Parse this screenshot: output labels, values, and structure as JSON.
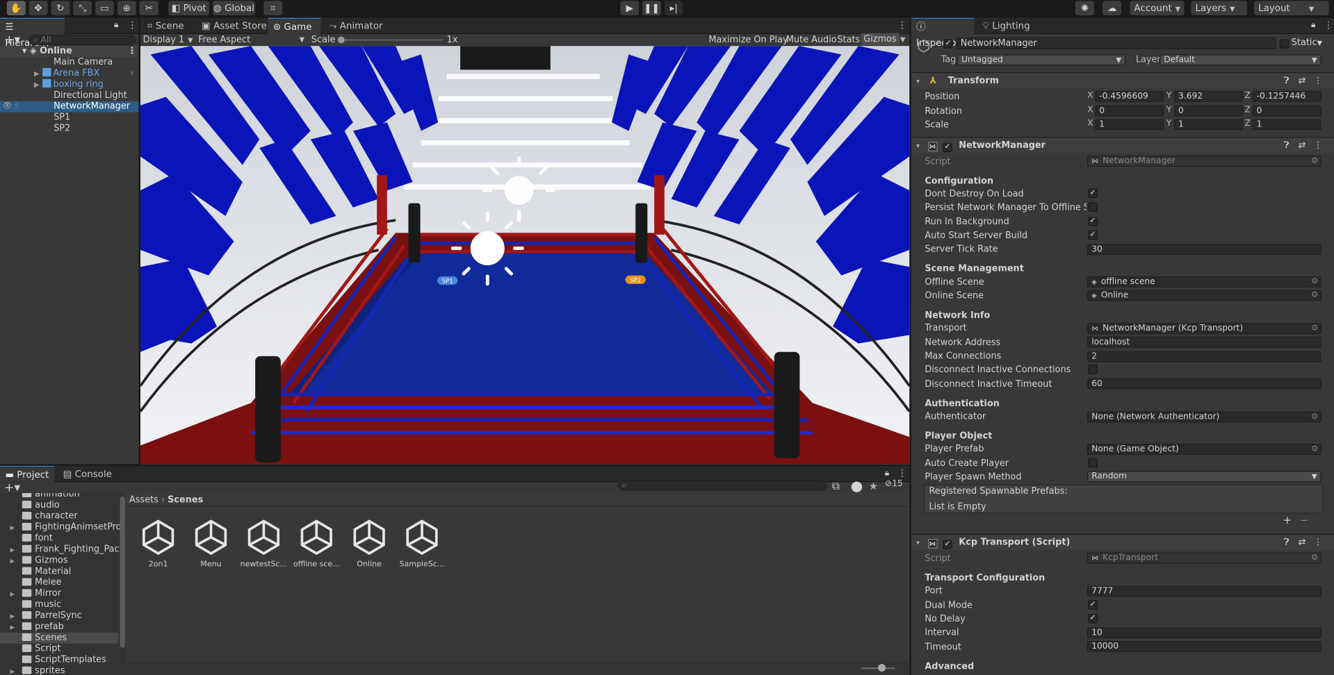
{
  "toolbar": {
    "pivot": "Pivot",
    "global": "Global",
    "account": "Account",
    "layers": "Layers",
    "layout": "Layout"
  },
  "hierarchy": {
    "tab": "Hierarchy",
    "search_placeholder": "All",
    "scene": "Online",
    "items": [
      "Main Camera",
      "Arena FBX",
      "boxing ring",
      "Directional Light",
      "NetworkManager",
      "SP1",
      "SP2"
    ]
  },
  "center": {
    "tabs": [
      "Scene",
      "Asset Store",
      "Game",
      "Animator"
    ],
    "display": "Display 1",
    "aspect": "Free Aspect",
    "scale_label": "Scale",
    "scale_value": "1x",
    "buttons": [
      "Maximize On Play",
      "Mute Audio",
      "Stats",
      "Gizmos"
    ],
    "spawn_labels": [
      "SP1",
      "SP2"
    ]
  },
  "project": {
    "tabs": [
      "Project",
      "Console"
    ],
    "breadcrumb": [
      "Assets",
      "Scenes"
    ],
    "hidden_count": "15",
    "folders": [
      "animation",
      "audio",
      "character",
      "FightingAnimsetPro",
      "font",
      "Frank_Fighting_Pack",
      "Gizmos",
      "Material",
      "Melee",
      "Mirror",
      "music",
      "ParrelSync",
      "prefab",
      "Scenes",
      "Script",
      "ScriptTemplates",
      "sprites"
    ],
    "scenes": [
      "2on1",
      "Menu",
      "newtestSc...",
      "offline sce...",
      "Online",
      "SampleSc..."
    ]
  },
  "inspector": {
    "tabs": [
      "Inspector",
      "Lighting"
    ],
    "object_name": "NetworkManager",
    "static_label": "Static",
    "tag_label": "Tag",
    "tag_value": "Untagged",
    "layer_label": "Layer",
    "layer_value": "Default",
    "transform": {
      "title": "Transform",
      "position_label": "Position",
      "rotation_label": "Rotation",
      "scale_label": "Scale",
      "position": [
        "-0.4596609",
        "3.692",
        "-0.1257446"
      ],
      "rotation": [
        "0",
        "0",
        "0"
      ],
      "scale": [
        "1",
        "1",
        "1"
      ]
    },
    "network_manager": {
      "title": "NetworkManager",
      "script_label": "Script",
      "script_value": "NetworkManager",
      "configuration": "Configuration",
      "dont_destroy": "Dont Destroy On Load",
      "persist": "Persist Network Manager To Offline Scen",
      "run_bg": "Run In Background",
      "auto_start": "Auto Start Server Build",
      "tick_rate_label": "Server Tick Rate",
      "tick_rate": "30",
      "scene_mgmt": "Scene Management",
      "offline_label": "Offline Scene",
      "offline_value": "offline scene",
      "online_label": "Online Scene",
      "online_value": "Online",
      "network_info": "Network Info",
      "transport_label": "Transport",
      "transport_value": "NetworkManager (Kcp Transport)",
      "address_label": "Network Address",
      "address": "localhost",
      "max_conn_label": "Max Connections",
      "max_conn": "2",
      "disc_inactive": "Disconnect Inactive Connections",
      "disc_timeout_label": "Disconnect Inactive Timeout",
      "disc_timeout": "60",
      "authentication": "Authentication",
      "authenticator_label": "Authenticator",
      "authenticator": "None (Network Authenticator)",
      "player_object": "Player Object",
      "player_prefab_label": "Player Prefab",
      "player_prefab": "None (Game Object)",
      "auto_create": "Auto Create Player",
      "spawn_method_label": "Player Spawn Method",
      "spawn_method": "Random",
      "registered": "Registered Spawnable Prefabs:",
      "list_empty": "List is Empty",
      "checks": {
        "dont_destroy": true,
        "persist": false,
        "run_bg": true,
        "auto_start": true,
        "disc_inactive": false,
        "auto_create": false
      }
    },
    "kcp": {
      "title": "Kcp Transport (Script)",
      "script_label": "Script",
      "script_value": "KcpTransport",
      "config": "Transport Configuration",
      "port_label": "Port",
      "port": "7777",
      "dual_label": "Dual Mode",
      "nodelay_label": "No Delay",
      "interval_label": "Interval",
      "interval": "10",
      "timeout_label": "Timeout",
      "timeout": "10000",
      "advanced": "Advanced"
    }
  },
  "colors": {
    "accent": "#2c5d87",
    "ring_blue": "#102a9a",
    "ring_red": "#7a1010",
    "seat_blue": "#0a14b8"
  }
}
